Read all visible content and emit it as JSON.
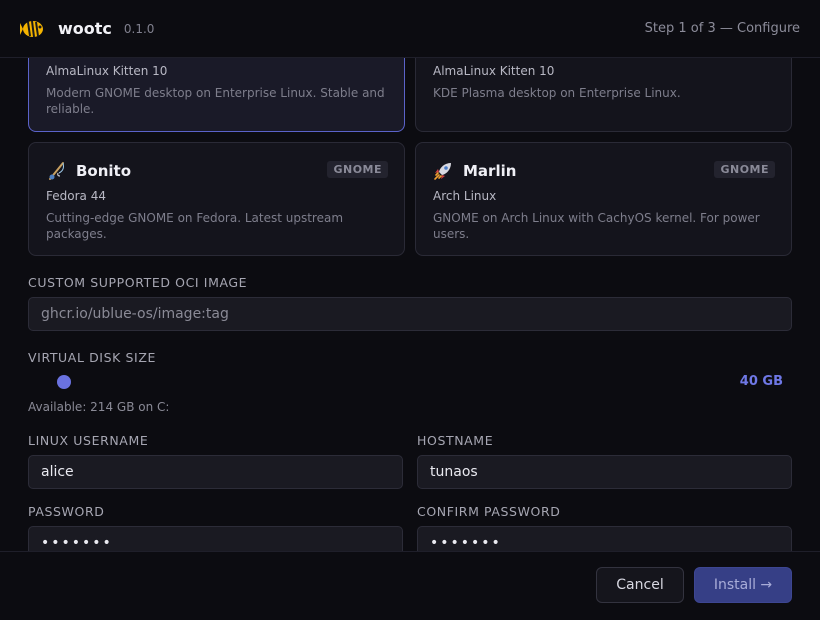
{
  "app": {
    "name": "wootc",
    "version": "0.1.0",
    "step": "Step 1 of 3 — Configure"
  },
  "cards": [
    {
      "name": "",
      "distro": "AlmaLinux Kitten 10",
      "description": "Modern GNOME desktop on Enterprise Linux. Stable and reliable.",
      "badge": "",
      "selected": true
    },
    {
      "name": "",
      "distro": "AlmaLinux Kitten 10",
      "description": "KDE Plasma desktop on Enterprise Linux.",
      "badge": "",
      "selected": false
    },
    {
      "name": "Bonito",
      "icon": "fishing-pole-icon",
      "distro": "Fedora 44",
      "description": "Cutting-edge GNOME on Fedora. Latest upstream packages.",
      "badge": "GNOME",
      "selected": false
    },
    {
      "name": "Marlin",
      "icon": "rocket-icon",
      "distro": "Arch Linux",
      "description": "GNOME on Arch Linux with CachyOS kernel. For power users.",
      "badge": "GNOME",
      "selected": false
    }
  ],
  "custom_image": {
    "label": "CUSTOM SUPPORTED OCI IMAGE",
    "placeholder": "ghcr.io/ublue-os/image:tag",
    "value": ""
  },
  "disk": {
    "label": "VIRTUAL DISK SIZE",
    "value": "40 GB",
    "available": "Available: 214 GB on C:"
  },
  "username": {
    "label": "LINUX USERNAME",
    "value": "alice"
  },
  "hostname": {
    "label": "HOSTNAME",
    "value": "tunaos"
  },
  "password": {
    "label": "PASSWORD",
    "value": "•••••••"
  },
  "confirm_password": {
    "label": "CONFIRM PASSWORD",
    "value": "•••••••"
  },
  "footer": {
    "cancel_label": "Cancel",
    "install_label": "Install →"
  },
  "colors": {
    "accent": "#6a72e0",
    "background": "#0c0c11",
    "card": "#14141c"
  }
}
